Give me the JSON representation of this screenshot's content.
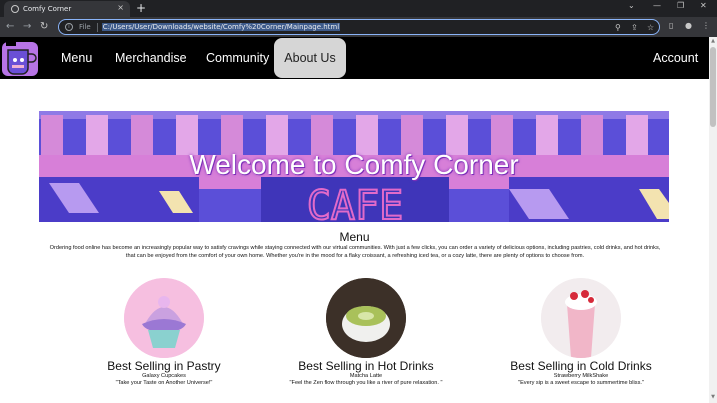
{
  "browser": {
    "tab_title": "Comfy Corner",
    "tab_close": "×",
    "new_tab": "+",
    "omnibox_label": "File",
    "url": "C:/Users/User/Downloads/website/Comfy%20Corner/Mainpage.html"
  },
  "nav": {
    "items": [
      "Menu",
      "Merchandise",
      "Community",
      "About Us"
    ],
    "active": "About Us",
    "account": "Account"
  },
  "banner": {
    "title": "Welcome to Comfy Corner",
    "sign": "CAFE"
  },
  "menu": {
    "title": "Menu",
    "intro": "Ordering food online has become an increasingly popular way to satisfy cravings while staying connected with our virtual communities. With just a few clicks, you can order a variety of delicious options, including pastries, cold drinks, and hot drinks, that can be enjoyed from the comfort of your own home. Whether you're in the mood for a flaky croissant, a refreshing iced tea, or a cozy latte, there are plenty of options to choose from."
  },
  "cards": [
    {
      "category": "Best Selling in Pastry",
      "item": "Galaxy Cupcakes",
      "quote": "\"Take your Taste on Another Universe!\""
    },
    {
      "category": "Best Selling in Hot Drinks",
      "item": "Matcha Latte",
      "quote": "\"Feel the Zen flow through you like a river of pure relaxation. \""
    },
    {
      "category": "Best Selling in Cold Drinks",
      "item": "Strawberry MilkShake",
      "quote": "\"Every sip is a sweet escape to summertime bliss.\""
    }
  ],
  "colors": {
    "nav_bg": "#000000",
    "banner_purple": "#6a4fd6",
    "banner_pink": "#d77fd8"
  }
}
